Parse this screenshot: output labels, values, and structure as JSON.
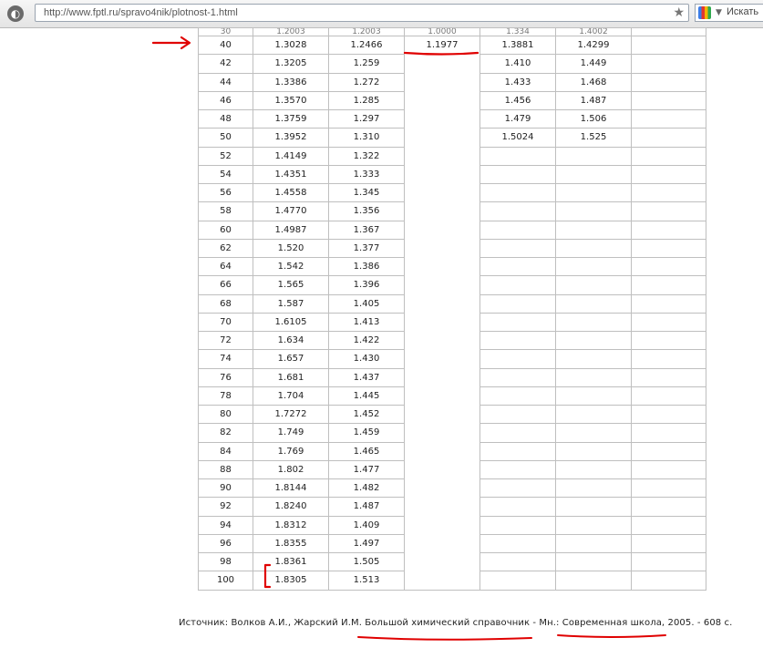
{
  "browser": {
    "url": "http://www.fptl.ru/spravo4nik/plotnost-1.html",
    "search_placeholder": "Искать"
  },
  "table": {
    "partial_row": [
      "30",
      "1.2003",
      "1.2003",
      "1.0000",
      "1.334",
      "1.4002",
      ""
    ],
    "rows": [
      [
        "40",
        "1.3028",
        "1.2466",
        "1.1977",
        "1.3881",
        "1.4299",
        ""
      ],
      [
        "42",
        "1.3205",
        "1.259",
        "",
        "1.410",
        "1.449",
        ""
      ],
      [
        "44",
        "1.3386",
        "1.272",
        "",
        "1.433",
        "1.468",
        ""
      ],
      [
        "46",
        "1.3570",
        "1.285",
        "",
        "1.456",
        "1.487",
        ""
      ],
      [
        "48",
        "1.3759",
        "1.297",
        "",
        "1.479",
        "1.506",
        ""
      ],
      [
        "50",
        "1.3952",
        "1.310",
        "",
        "1.5024",
        "1.525",
        ""
      ],
      [
        "52",
        "1.4149",
        "1.322",
        "",
        "",
        "",
        ""
      ],
      [
        "54",
        "1.4351",
        "1.333",
        "",
        "",
        "",
        ""
      ],
      [
        "56",
        "1.4558",
        "1.345",
        "",
        "",
        "",
        ""
      ],
      [
        "58",
        "1.4770",
        "1.356",
        "",
        "",
        "",
        ""
      ],
      [
        "60",
        "1.4987",
        "1.367",
        "",
        "",
        "",
        ""
      ],
      [
        "62",
        "1.520",
        "1.377",
        "",
        "",
        "",
        ""
      ],
      [
        "64",
        "1.542",
        "1.386",
        "",
        "",
        "",
        ""
      ],
      [
        "66",
        "1.565",
        "1.396",
        "",
        "",
        "",
        ""
      ],
      [
        "68",
        "1.587",
        "1.405",
        "",
        "",
        "",
        ""
      ],
      [
        "70",
        "1.6105",
        "1.413",
        "",
        "",
        "",
        ""
      ],
      [
        "72",
        "1.634",
        "1.422",
        "",
        "",
        "",
        ""
      ],
      [
        "74",
        "1.657",
        "1.430",
        "",
        "",
        "",
        ""
      ],
      [
        "76",
        "1.681",
        "1.437",
        "",
        "",
        "",
        ""
      ],
      [
        "78",
        "1.704",
        "1.445",
        "",
        "",
        "",
        ""
      ],
      [
        "80",
        "1.7272",
        "1.452",
        "",
        "",
        "",
        ""
      ],
      [
        "82",
        "1.749",
        "1.459",
        "",
        "",
        "",
        ""
      ],
      [
        "84",
        "1.769",
        "1.465",
        "",
        "",
        "",
        ""
      ],
      [
        "88",
        "1.802",
        "1.477",
        "",
        "",
        "",
        ""
      ],
      [
        "90",
        "1.8144",
        "1.482",
        "",
        "",
        "",
        ""
      ],
      [
        "92",
        "1.8240",
        "1.487",
        "",
        "",
        "",
        ""
      ],
      [
        "94",
        "1.8312",
        "1.409",
        "",
        "",
        "",
        ""
      ],
      [
        "96",
        "1.8355",
        "1.497",
        "",
        "",
        "",
        ""
      ],
      [
        "98",
        "1.8361",
        "1.505",
        "",
        "",
        "",
        ""
      ],
      [
        "100",
        "1.8305",
        "1.513",
        "",
        "",
        "",
        ""
      ]
    ]
  },
  "source_text": "Источник: Волков А.И., Жарский И.М. Большой химический справочник - Мн.: Современная школа, 2005. - 608 с.",
  "colors": {
    "annotation_red": "#e00000",
    "grid": "#bfbfbf",
    "toolbar": "#ececec"
  },
  "icons": [
    "globe-icon",
    "bookmark-star-icon",
    "google-search-icon",
    "chevron-down-icon"
  ]
}
